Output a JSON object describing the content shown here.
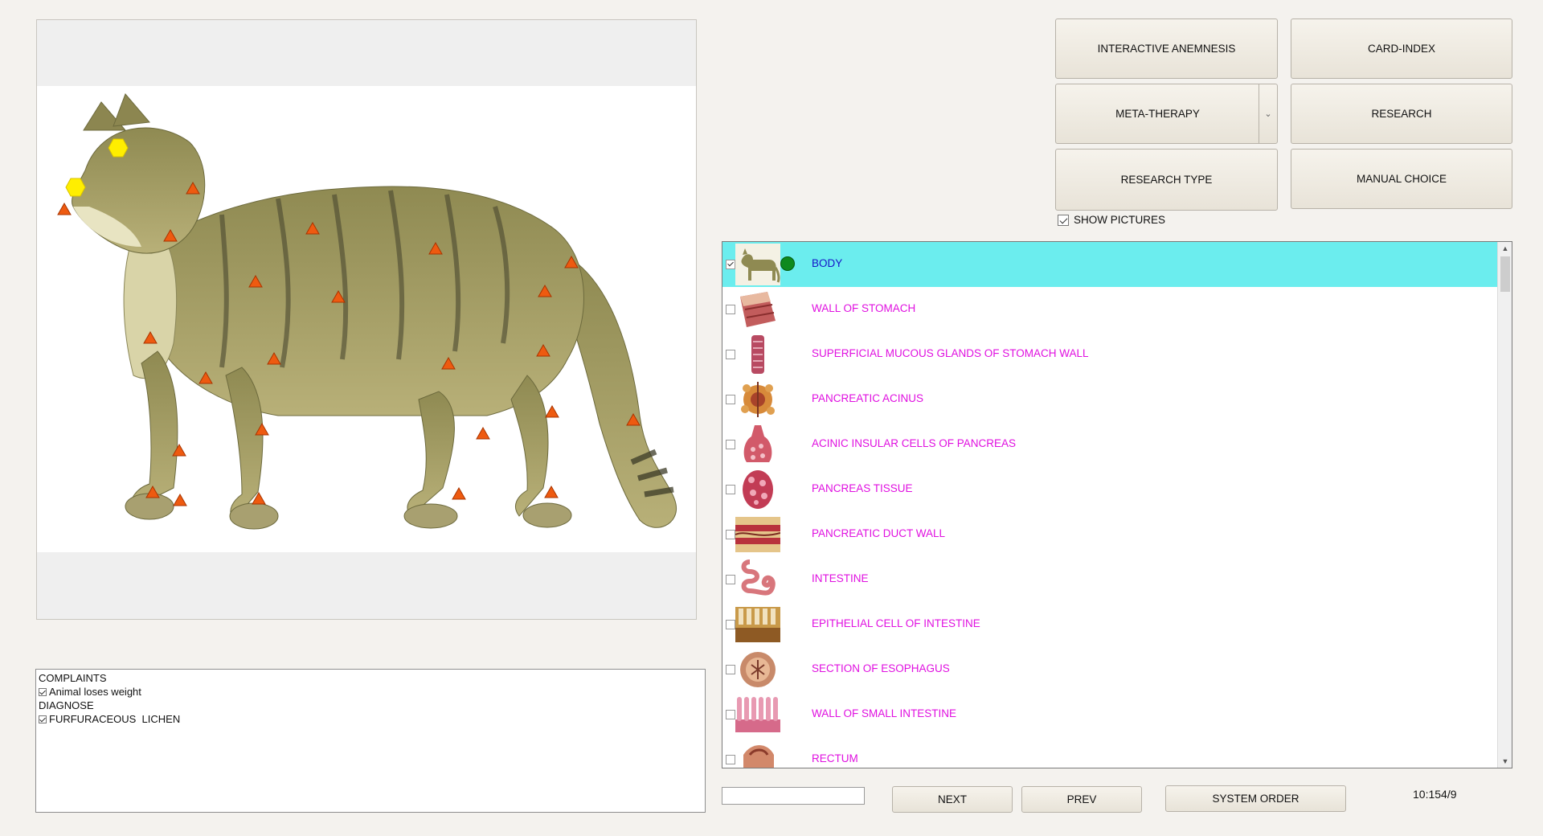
{
  "buttons": {
    "interactive_anemnesis": "INTERACTIVE ANEMNESIS",
    "card_index": "CARD-INDEX",
    "meta_therapy": "META-THERAPY",
    "research": "RESEARCH",
    "research_type": "RESEARCH TYPE",
    "manual_choice": "MANUAL CHOICE",
    "next": "NEXT",
    "prev": "PREV",
    "system_order": "SYSTEM ORDER"
  },
  "show_pictures": {
    "label": "SHOW PICTURES",
    "checked": true
  },
  "image_panel": {
    "markers": {
      "hexagons": 2,
      "triangles": 24
    }
  },
  "complaints": {
    "complaints_header": "COMPLAINTS",
    "complaint_item": "Animal loses weight",
    "diagnose_header": "DIAGNOSE",
    "diagnose_item": "FURFURACEOUS  LICHEN"
  },
  "organ_list": {
    "items": [
      {
        "label": "BODY",
        "selected": true,
        "checked": true,
        "status": "green",
        "icon": "cat-thumbnail"
      },
      {
        "label": "WALL OF STOMACH",
        "icon": "stomach-wall-thumbnail"
      },
      {
        "label": "SUPERFICIAL MUCOUS GLANDS OF STOMACH WALL",
        "icon": "mucous-glands-thumbnail"
      },
      {
        "label": "PANCREATIC ACINUS",
        "icon": "pancreatic-acinus-thumbnail"
      },
      {
        "label": "ACINIC INSULAR CELLS OF PANCREAS",
        "icon": "insular-cells-thumbnail"
      },
      {
        "label": "PANCREAS  TISSUE",
        "icon": "pancreas-tissue-thumbnail"
      },
      {
        "label": "PANCREATIC DUCT WALL",
        "icon": "duct-wall-thumbnail"
      },
      {
        "label": "INTESTINE",
        "icon": "intestine-thumbnail"
      },
      {
        "label": "EPITHELIAL CELL OF INTESTINE",
        "icon": "epithelial-cell-thumbnail"
      },
      {
        "label": "SECTION OF ESOPHAGUS",
        "icon": "esophagus-section-thumbnail"
      },
      {
        "label": "WALL  OF  SMALL  INTESTINE",
        "icon": "small-intestine-wall-thumbnail"
      },
      {
        "label": "RECTUM",
        "icon": "rectum-thumbnail"
      }
    ]
  },
  "search": {
    "value": ""
  },
  "status": {
    "counter": "10:154/9"
  },
  "colors": {
    "selected_row": "#6bedee",
    "item_label": "#e010e0",
    "selected_label": "#1414c8",
    "marker_triangle": "#ee5a10",
    "marker_hexagon": "#ffee00",
    "status_dot": "#0e8a1e"
  }
}
